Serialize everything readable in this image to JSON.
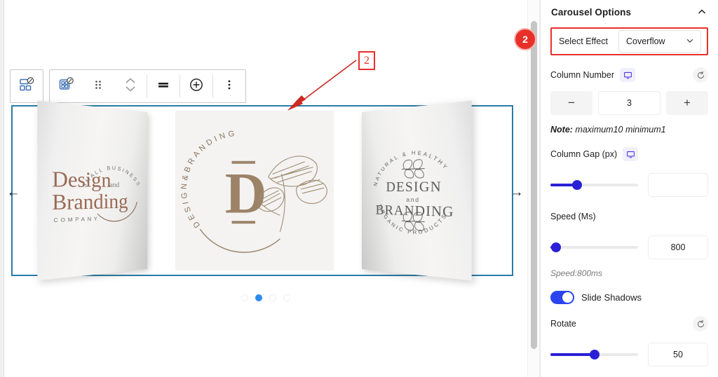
{
  "canvas": {
    "toolbar": {
      "buttons": [
        {
          "name": "change-block-type-button",
          "icon": "blocks-badge-icon"
        },
        {
          "name": "select-parent-block-button",
          "icon": "grid-badge-icon"
        },
        {
          "name": "drag-handle-button",
          "icon": "drag-dots-icon"
        },
        {
          "name": "move-up-down-button",
          "icon": "chevron-up-down-icon"
        },
        {
          "name": "align-button",
          "icon": "align-bars-icon"
        },
        {
          "name": "add-block-button",
          "icon": "plus-circle-icon"
        },
        {
          "name": "more-options-button",
          "icon": "vertical-dots-icon"
        }
      ]
    },
    "carousel": {
      "prev_label": "←",
      "next_label": "→",
      "slides": [
        {
          "name": "slide-design-branding-company",
          "arc_top": "SMALL BUSINESS",
          "title_line1": "Design",
          "title_small": "and",
          "title_line2": "Branding",
          "subtitle": "COMPANY"
        },
        {
          "name": "slide-design-and-branding-monogram",
          "arc_top": "DESIGN&BRANDING",
          "monogram": "D"
        },
        {
          "name": "slide-natural-healthy-organic",
          "arc_top": "NATURAL & HEALTHY",
          "title_line1": "DESIGN",
          "title_small": "and",
          "title_line2": "BRANDING",
          "arc_bottom": "ORGANIC PRODUCTS"
        }
      ],
      "dots": [
        {
          "state": "idle"
        },
        {
          "state": "active"
        },
        {
          "state": "idle"
        },
        {
          "state": "idle"
        }
      ]
    },
    "annotation": {
      "label": "2",
      "color": "#e8302a"
    }
  },
  "badge": {
    "label": "2",
    "color": "#e8302a"
  },
  "panel": {
    "title": "Carousel Options",
    "collapse_icon": "chevron-up-icon",
    "select_effect": {
      "label": "Select Effect",
      "value": "Coverflow",
      "icon": "chevron-down-icon"
    },
    "column_number": {
      "label": "Column Number",
      "device_icon": "desktop-icon",
      "reset_icon": "reset-icon",
      "minus_label": "−",
      "plus_label": "+",
      "value": "3"
    },
    "note": {
      "prefix": "Note:",
      "text": " maximum10 minimum1"
    },
    "column_gap": {
      "label": "Column Gap (px)",
      "device_icon": "desktop-icon",
      "value": "",
      "slider_percent": 30
    },
    "speed": {
      "label": "Speed (Ms)",
      "value": "800",
      "slider_percent": 6,
      "sub_note": "Speed:800ms"
    },
    "slide_shadows": {
      "label": "Slide Shadows",
      "enabled": true
    },
    "rotate": {
      "label": "Rotate",
      "reset_icon": "reset-icon",
      "value": "50",
      "slider_percent": 50
    },
    "accent_color": "#2a20d6"
  }
}
